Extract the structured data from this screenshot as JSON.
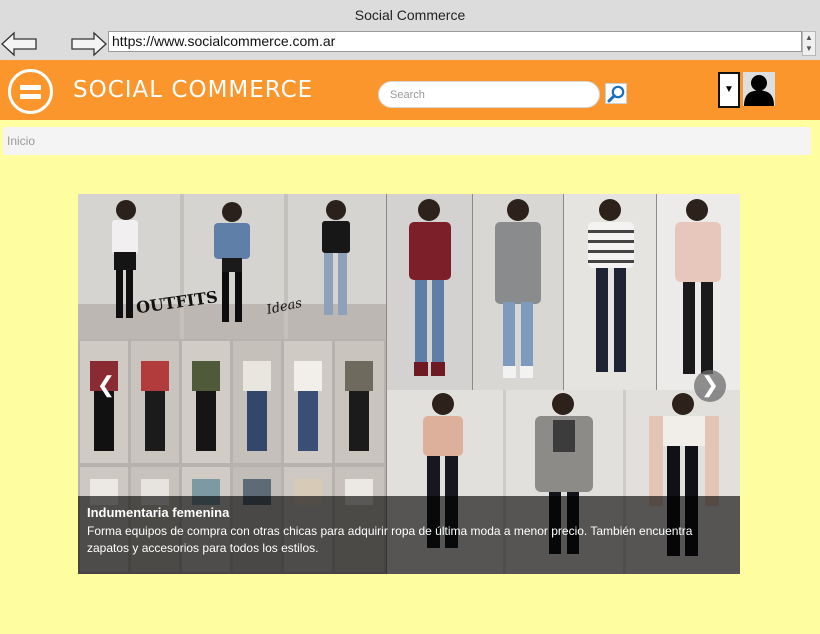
{
  "browser": {
    "window_title": "Social Commerce",
    "url": "https://www.socialcommerce.com.ar"
  },
  "header": {
    "brand": "SOCIAL COMMERCE",
    "search_placeholder": "Search",
    "accent_color": "#fb962c"
  },
  "breadcrumb": {
    "current": "Inicio"
  },
  "carousel": {
    "image_overlay_text": [
      "OUTFITS",
      "Ideas"
    ],
    "prev_glyph": "❮",
    "next_glyph": "❯",
    "caption": {
      "title": "Indumentaria femenina",
      "text": "Forma equipos de compra con otras chicas para adquirir ropa de última moda a menor precio. También encuentra zapatos y accesorios para todos los estilos."
    }
  }
}
